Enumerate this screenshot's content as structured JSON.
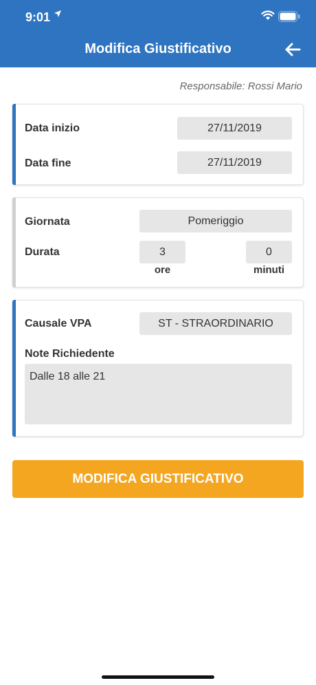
{
  "status_bar": {
    "time": "9:01"
  },
  "header": {
    "title": "Modifica Giustificativo"
  },
  "responsabile": "Responsabile: Rossi Mario",
  "dates_card": {
    "start_label": "Data inizio",
    "start_value": "27/11/2019",
    "end_label": "Data fine",
    "end_value": "27/11/2019"
  },
  "duration_card": {
    "day_label": "Giornata",
    "day_value": "Pomeriggio",
    "duration_label": "Durata",
    "hours_value": "3",
    "hours_unit": "ore",
    "minutes_value": "0",
    "minutes_unit": "minuti"
  },
  "reason_card": {
    "causale_label": "Causale VPA",
    "causale_value": "ST - STRAORDINARIO",
    "notes_label": "Note Richiedente",
    "notes_value": "Dalle 18 alle 21"
  },
  "submit_button": {
    "label": "MODIFICA GIUSTIFICATIVO"
  },
  "colors": {
    "primary": "#2f74c0",
    "accent": "#f4a621",
    "field_bg": "#e6e6e6"
  },
  "icons": {
    "location": "location-arrow-icon",
    "wifi": "wifi-icon",
    "battery": "battery-icon",
    "back": "back-arrow-icon"
  }
}
